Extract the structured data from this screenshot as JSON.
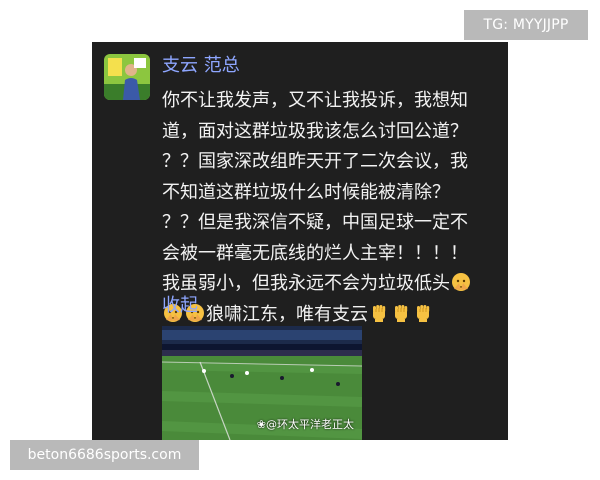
{
  "overlays": {
    "top_right": "TG: MYYJJPP",
    "bottom_left": "beton6686sports.com"
  },
  "post": {
    "author": "支云 范总",
    "content_lines": [
      "你不让我发声，又不让我投诉，我想知",
      "道，面对这群垃圾我该怎么讨回公道？",
      "？？国家深改组昨天开了二次会议，我",
      "不知道这群垃圾什么时候能被清除？",
      "？？但是我深信不疑，中国足球一定不",
      "会被一群毫无底线的烂人主宰！！！！",
      "我虽弱小，但我永远不会为垃圾低头",
      "狼啸江东，唯有支云"
    ],
    "collapse_label": "收起",
    "video_watermark": "@环太平洋老正太",
    "icons": {
      "avatar": "avatar-image",
      "face_emoji": "praying-face-emoji",
      "fist_emoji": "raised-fist-emoji",
      "watermark_logo": "weibo-logo-icon"
    },
    "colors": {
      "background": "#1f1f1f",
      "text": "#f2f2f2",
      "link": "#8ea6ff",
      "pitch": "#3f7a34"
    }
  }
}
